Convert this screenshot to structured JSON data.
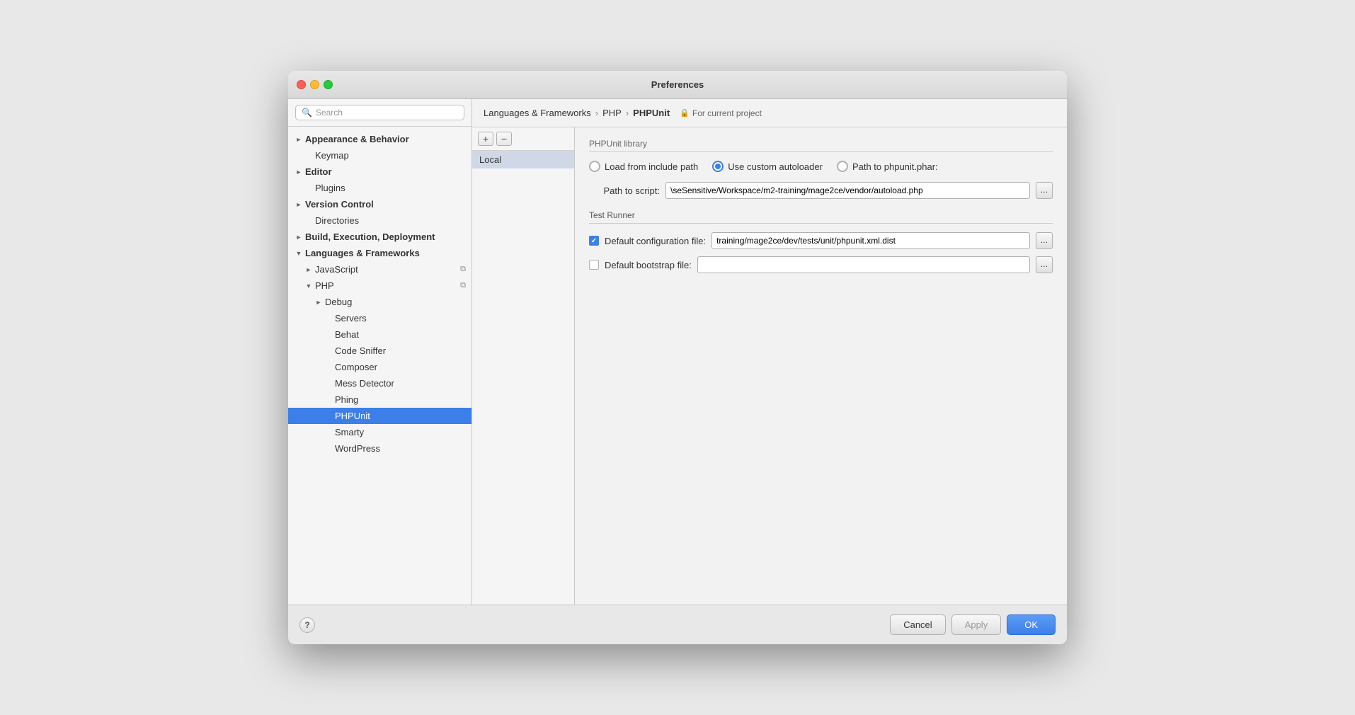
{
  "window": {
    "title": "Preferences"
  },
  "sidebar": {
    "search_placeholder": "Search",
    "items": [
      {
        "id": "appearance",
        "label": "Appearance & Behavior",
        "level": 0,
        "expand": "collapsed",
        "bold": true
      },
      {
        "id": "keymap",
        "label": "Keymap",
        "level": 0,
        "expand": "leaf",
        "bold": false
      },
      {
        "id": "editor",
        "label": "Editor",
        "level": 0,
        "expand": "collapsed",
        "bold": true
      },
      {
        "id": "plugins",
        "label": "Plugins",
        "level": 0,
        "expand": "leaf",
        "bold": false
      },
      {
        "id": "version-control",
        "label": "Version Control",
        "level": 0,
        "expand": "collapsed",
        "bold": true
      },
      {
        "id": "directories",
        "label": "Directories",
        "level": 0,
        "expand": "leaf",
        "bold": false
      },
      {
        "id": "build",
        "label": "Build, Execution, Deployment",
        "level": 0,
        "expand": "collapsed",
        "bold": true
      },
      {
        "id": "languages",
        "label": "Languages & Frameworks",
        "level": 0,
        "expand": "expanded",
        "bold": true
      },
      {
        "id": "javascript",
        "label": "JavaScript",
        "level": 1,
        "expand": "collapsed",
        "copy": true
      },
      {
        "id": "php",
        "label": "PHP",
        "level": 1,
        "expand": "expanded",
        "copy": true
      },
      {
        "id": "debug",
        "label": "Debug",
        "level": 2,
        "expand": "collapsed"
      },
      {
        "id": "servers",
        "label": "Servers",
        "level": 2,
        "expand": "leaf"
      },
      {
        "id": "behat",
        "label": "Behat",
        "level": 2,
        "expand": "leaf"
      },
      {
        "id": "code-sniffer",
        "label": "Code Sniffer",
        "level": 2,
        "expand": "leaf"
      },
      {
        "id": "composer",
        "label": "Composer",
        "level": 2,
        "expand": "leaf"
      },
      {
        "id": "mess-detector",
        "label": "Mess Detector",
        "level": 2,
        "expand": "leaf"
      },
      {
        "id": "phing",
        "label": "Phing",
        "level": 2,
        "expand": "leaf"
      },
      {
        "id": "phpunit",
        "label": "PHPUnit",
        "level": 2,
        "expand": "leaf",
        "selected": true
      },
      {
        "id": "smarty",
        "label": "Smarty",
        "level": 2,
        "expand": "leaf"
      },
      {
        "id": "wordpress",
        "label": "WordPress",
        "level": 2,
        "expand": "leaf"
      }
    ]
  },
  "breadcrumb": {
    "items": [
      "Languages & Frameworks",
      "PHP",
      "PHPUnit"
    ],
    "badge": "For current project"
  },
  "list_panel": {
    "add_label": "+",
    "remove_label": "−",
    "items": [
      {
        "id": "local",
        "label": "Local",
        "selected": true
      }
    ]
  },
  "config": {
    "phpunit_library_section": "PHPUnit library",
    "radio_options": [
      {
        "id": "load-from-include",
        "label": "Load from include path",
        "checked": false
      },
      {
        "id": "use-custom-autoloader",
        "label": "Use custom autoloader",
        "checked": true
      },
      {
        "id": "path-to-phpunit-phar",
        "label": "Path to phpunit.phar:",
        "checked": false
      }
    ],
    "path_to_script_label": "Path to script:",
    "path_to_script_value": "\\seSensitive/Workspace/m2-training/mage2ce/vendor/autoload.php",
    "test_runner_section": "Test Runner",
    "default_config_file_label": "Default configuration file:",
    "default_config_file_checked": true,
    "default_config_file_value": "training/mage2ce/dev/tests/unit/phpunit.xml.dist",
    "default_bootstrap_label": "Default bootstrap file:",
    "default_bootstrap_checked": false,
    "default_bootstrap_value": ""
  },
  "bottom_bar": {
    "help_label": "?",
    "cancel_label": "Cancel",
    "apply_label": "Apply",
    "ok_label": "OK"
  }
}
